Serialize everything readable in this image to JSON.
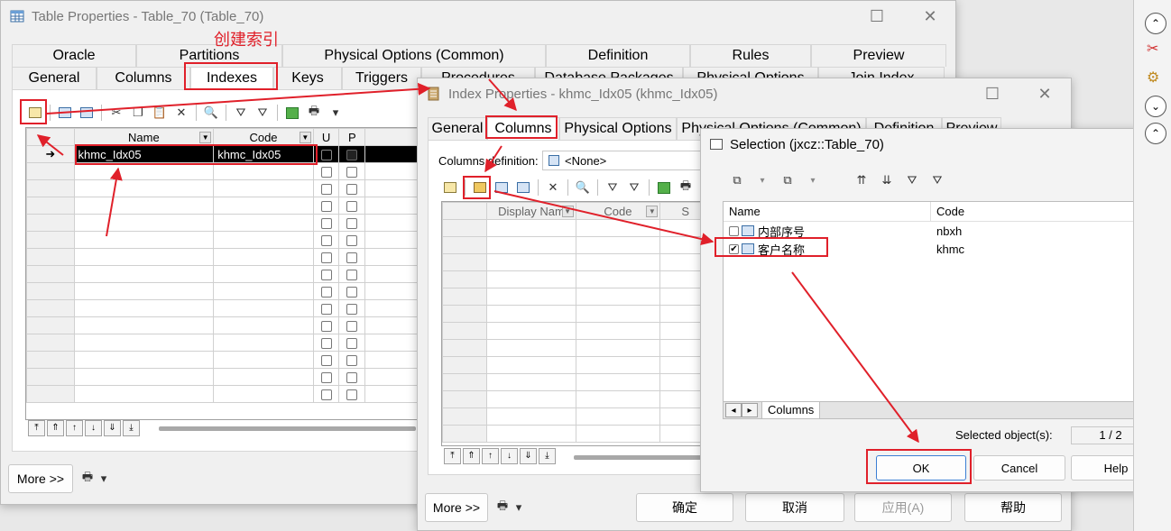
{
  "table_window": {
    "title": "Table Properties - Table_70 (Table_70)",
    "tabs_row1": [
      "Oracle",
      "Partitions",
      "Physical Options (Common)",
      "Definition",
      "Rules",
      "Preview"
    ],
    "tabs_row2": [
      "General",
      "Columns",
      "Indexes",
      "Keys",
      "Triggers",
      "Procedures",
      "Database Packages",
      "Physical Options",
      "Join Index"
    ],
    "grid_headers": {
      "name": "Name",
      "code": "Code",
      "u": "U",
      "p": "P"
    },
    "index_row": {
      "marker": "➜",
      "name": "khmc_Idx05",
      "code": "khmc_Idx05"
    },
    "more_button": "More >>"
  },
  "annotation": {
    "create_index": "创建索引"
  },
  "index_window": {
    "title": "Index Properties - khmc_Idx05 (khmc_Idx05)",
    "tabs": [
      "General",
      "Columns",
      "Physical Options",
      "Physical Options (Common)",
      "Definition",
      "Preview"
    ],
    "columns_definition_label": "Columns definition:",
    "columns_definition_value": "<None>",
    "grid_headers": {
      "display_name": "Display Nam",
      "code": "Code",
      "s": "S"
    },
    "more_button": "More >>",
    "buttons": {
      "ok": "确定",
      "cancel": "取消",
      "apply": "应用(A)",
      "help": "帮助"
    }
  },
  "selection_window": {
    "title": "Selection (jxcz::Table_70)",
    "list_headers": {
      "name": "Name",
      "code": "Code"
    },
    "items": [
      {
        "name": "内部序号",
        "code": "nbxh",
        "checked": false
      },
      {
        "name": "客户名称",
        "code": "khmc",
        "checked": true
      }
    ],
    "bottom_tab": "Columns",
    "selected_label": "Selected object(s):",
    "selected_value": "1 / 2",
    "buttons": {
      "ok": "OK",
      "cancel": "Cancel",
      "help": "Help"
    }
  },
  "colors": {
    "annotation_red": "#e0202a",
    "selected_row": "#000000"
  }
}
